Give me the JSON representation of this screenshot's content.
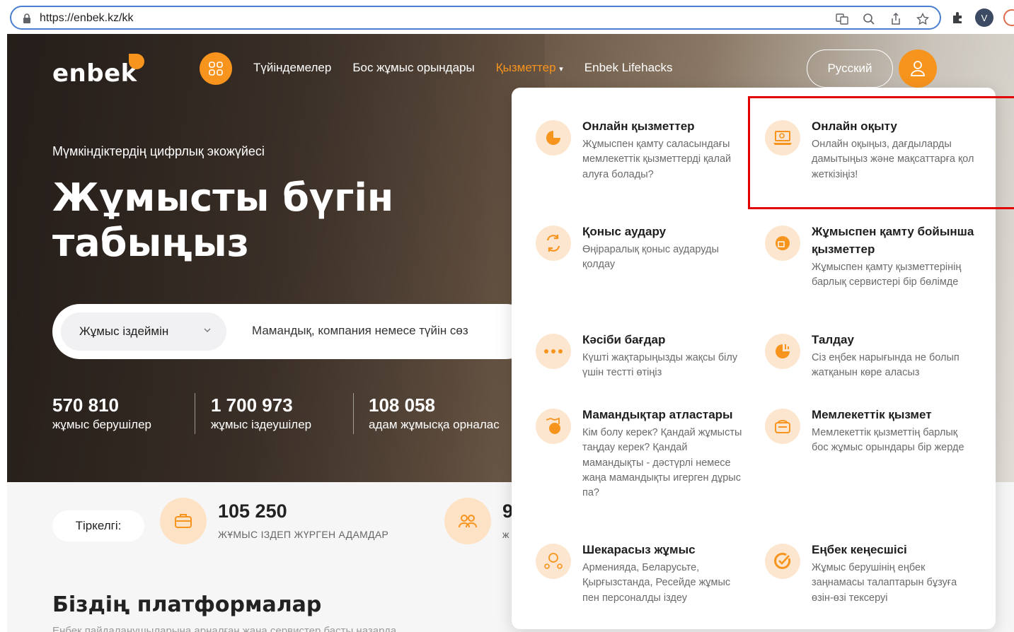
{
  "browser": {
    "url": "https://enbek.kz/kk",
    "avatar_letter": "V"
  },
  "header": {
    "logo": "enbek",
    "nav": [
      "Түйіндемелер",
      "Бос жұмыс орындары",
      "Қызметтер",
      "Enbek Lifehacks"
    ],
    "language_button": "Русский"
  },
  "hero": {
    "tagline": "Мүмкіндіктердің цифрлық экожүйесі",
    "title": "Жұмысты бүгін табыңыз",
    "search": {
      "select_value": "Жұмыс іздеймін",
      "placeholder": "Мамандық, компания немесе түйін сөз"
    },
    "stats": [
      {
        "num": "570 810",
        "label": "жұмыс берушілер"
      },
      {
        "num": "1 700 973",
        "label": "жұмыс іздеушілер"
      },
      {
        "num": "108 058",
        "label": "адам жұмысқа орналас"
      }
    ]
  },
  "registered": {
    "label": "Тіркелгі:",
    "count": "105 250",
    "count_label": "жұмыс іздеп жүрген адамдар",
    "count2": "9",
    "count2_label": "ж"
  },
  "platforms": {
    "title": "Біздің платформалар",
    "subtitle": "Еңбек пайдаланушыларына арналған жаңа сервистер басты назарда"
  },
  "mega_menu": {
    "items": [
      {
        "title": "Онлайн қызметтер",
        "desc": "Жұмыспен қамту саласындағы мемлекеттік қызметтерді қалай алуға болады?"
      },
      {
        "title": "Онлайн оқыту",
        "desc": "Онлайн оқыңыз, дағдыларды дамытыңыз және мақсаттарға қол жеткізіңіз!"
      },
      {
        "title": "Қоныс аудару",
        "desc": "Өңіраралық қоныс аударуды қолдау"
      },
      {
        "title": "Жұмыспен қамту бойынша қызметтер",
        "desc": "Жұмыспен қамту қызметтерінің барлық сервистері бір бөлімде"
      },
      {
        "title": "Кәсіби бағдар",
        "desc": "Күшті жақтарыңызды жақсы білу үшін тестті өтіңіз"
      },
      {
        "title": "Талдау",
        "desc": "Сіз еңбек нарығында не болып жатқанын көре аласыз"
      },
      {
        "title": "Мамандықтар атластары",
        "desc": "Кім болу керек? Қандай жұмысты таңдау керек? Қандай мамандықты - дәстүрлі немесе жаңа мамандықты игерген дұрыс па?"
      },
      {
        "title": "Мемлекеттік қызмет",
        "desc": "Мемлекеттік қызметтің барлық бос жұмыс орындары бір жерде"
      },
      {
        "title": "Шекарасыз жұмыс",
        "desc": "Арменияда, Беларусьте, Қырғызстанда, Ресейде жұмыс пен персоналды іздеу"
      },
      {
        "title": "Еңбек кеңесшісі",
        "desc": "Жұмыс берушінің еңбек заңнамасы талаптарын бұзуға өзін-өзі тексеруі"
      }
    ]
  },
  "colors": {
    "accent": "#f7941d",
    "highlight": "#e00000"
  }
}
